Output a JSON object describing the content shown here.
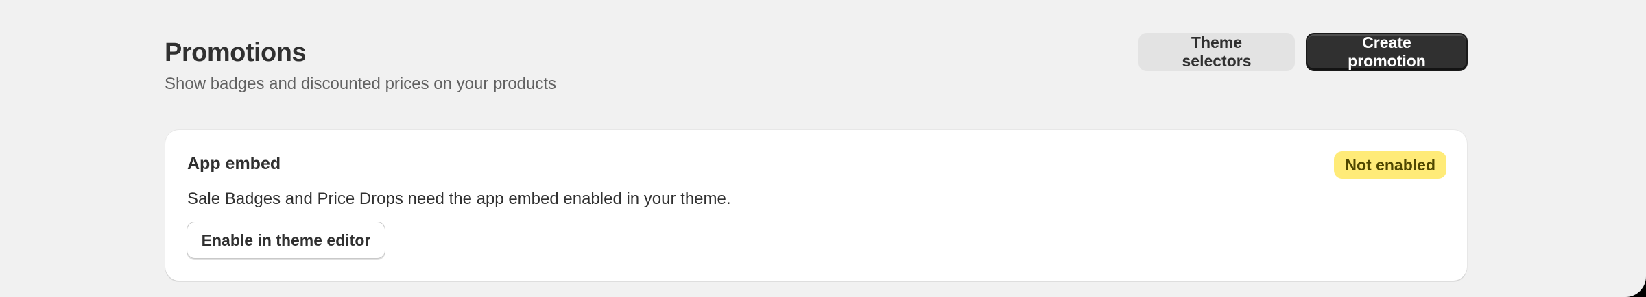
{
  "header": {
    "title": "Promotions",
    "subtitle": "Show badges and discounted prices on your products",
    "actions": {
      "theme_selectors_label": "Theme selectors",
      "create_promotion_label": "Create promotion"
    }
  },
  "app_embed_card": {
    "title": "App embed",
    "status": "Not enabled",
    "description": "Sale Badges and Price Drops need the app embed enabled in your theme.",
    "button_label": "Enable in theme editor"
  },
  "colors": {
    "page_background": "#f1f1f1",
    "primary_button": "#303030",
    "secondary_button": "#e3e3e3",
    "status_badge_background": "#ffeb78",
    "status_badge_text": "#4f4700"
  }
}
